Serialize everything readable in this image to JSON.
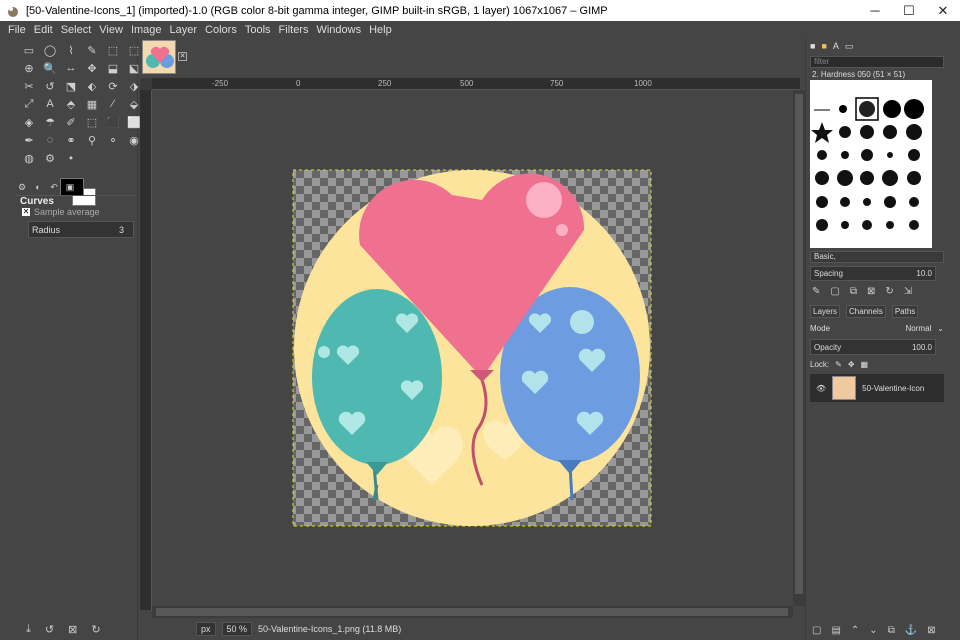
{
  "window": {
    "title": "[50-Valentine-Icons_1] (imported)-1.0 (RGB color 8-bit gamma integer, GIMP built-in sRGB, 1 layer) 1067x1067 – GIMP",
    "minimize": "─",
    "maximize": "☐",
    "close": "✕"
  },
  "menubar": [
    "File",
    "Edit",
    "Select",
    "View",
    "Image",
    "Layer",
    "Colors",
    "Tools",
    "Filters",
    "Windows",
    "Help"
  ],
  "toolbox": {
    "tool_icons": [
      "▭",
      "◯",
      "⌇",
      "✎",
      "⬚",
      "⬚",
      "⊕",
      "🔍",
      "↔",
      "✥",
      "⬓",
      "⬕",
      "✂",
      "↺",
      "⬔",
      "⬖",
      "⟳",
      "⬗",
      "⤢",
      "A",
      "⬘",
      "▦",
      "⁄",
      "⬙",
      "◈",
      "☂",
      "✐",
      "⬚",
      "⬛",
      "⬜",
      "✒",
      "◌",
      "⚭",
      "⚲",
      "⚬",
      "◉",
      "◍",
      "⚙",
      "⬩"
    ],
    "options_title": "Curves",
    "sample_average": "Sample average",
    "radius_label": "Radius",
    "radius_value": "3"
  },
  "ruler": {
    "top_ticks": [
      "-250",
      "0",
      "250",
      "500",
      "750",
      "1000"
    ]
  },
  "status": {
    "unit": "px",
    "zoom": "50 %",
    "file": "50-Valentine-Icons_1.png (11.8 MB)"
  },
  "brushes": {
    "filter_placeholder": "filter",
    "selected": "2. Hardness 050 (51 × 51)",
    "preset": "Basic,",
    "spacing_label": "Spacing",
    "spacing_value": "10.0"
  },
  "layers": {
    "tabs": [
      "Layers",
      "Channels",
      "Paths"
    ],
    "mode_label": "Mode",
    "mode_value": "Normal",
    "opacity_label": "Opacity",
    "opacity_value": "100.0",
    "lock_label": "Lock:",
    "layer_name": "50-Valentine-Icon"
  },
  "colors": {
    "bg": "#454545",
    "circle": "#fde49c",
    "pink_heart": "#f07090",
    "teal": "#4fb8b0",
    "blue": "#6d9de0"
  }
}
